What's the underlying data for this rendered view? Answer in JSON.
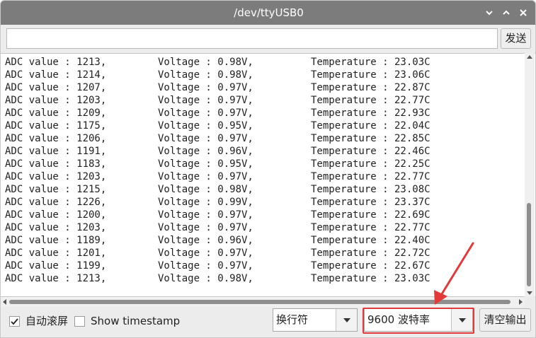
{
  "window": {
    "title": "/dev/ttyUSB0",
    "min_glyph": "▾",
    "max_glyph": "▴",
    "close_glyph": "✕"
  },
  "send": {
    "input_value": "",
    "button_label": "发送"
  },
  "output": {
    "lines": [
      {
        "adc": "ADC value : 1213,",
        "voltage": "Voltage : 0.98V,",
        "temperature": "Temperature : 23.03C"
      },
      {
        "adc": "ADC value : 1214,",
        "voltage": "Voltage : 0.98V,",
        "temperature": "Temperature : 23.06C"
      },
      {
        "adc": "ADC value : 1207,",
        "voltage": "Voltage : 0.97V,",
        "temperature": "Temperature : 22.87C"
      },
      {
        "adc": "ADC value : 1203,",
        "voltage": "Voltage : 0.97V,",
        "temperature": "Temperature : 22.77C"
      },
      {
        "adc": "ADC value : 1209,",
        "voltage": "Voltage : 0.97V,",
        "temperature": "Temperature : 22.93C"
      },
      {
        "adc": "ADC value : 1175,",
        "voltage": "Voltage : 0.95V,",
        "temperature": "Temperature : 22.04C"
      },
      {
        "adc": "ADC value : 1206,",
        "voltage": "Voltage : 0.97V,",
        "temperature": "Temperature : 22.85C"
      },
      {
        "adc": "ADC value : 1191,",
        "voltage": "Voltage : 0.96V,",
        "temperature": "Temperature : 22.46C"
      },
      {
        "adc": "ADC value : 1183,",
        "voltage": "Voltage : 0.95V,",
        "temperature": "Temperature : 22.25C"
      },
      {
        "adc": "ADC value : 1203,",
        "voltage": "Voltage : 0.97V,",
        "temperature": "Temperature : 22.77C"
      },
      {
        "adc": "ADC value : 1215,",
        "voltage": "Voltage : 0.98V,",
        "temperature": "Temperature : 23.08C"
      },
      {
        "adc": "ADC value : 1226,",
        "voltage": "Voltage : 0.99V,",
        "temperature": "Temperature : 23.37C"
      },
      {
        "adc": "ADC value : 1200,",
        "voltage": "Voltage : 0.97V,",
        "temperature": "Temperature : 22.69C"
      },
      {
        "adc": "ADC value : 1203,",
        "voltage": "Voltage : 0.97V,",
        "temperature": "Temperature : 22.77C"
      },
      {
        "adc": "ADC value : 1189,",
        "voltage": "Voltage : 0.96V,",
        "temperature": "Temperature : 22.40C"
      },
      {
        "adc": "ADC value : 1201,",
        "voltage": "Voltage : 0.97V,",
        "temperature": "Temperature : 22.72C"
      },
      {
        "adc": "ADC value : 1199,",
        "voltage": "Voltage : 0.97V,",
        "temperature": "Temperature : 22.67C"
      },
      {
        "adc": "ADC value : 1213,",
        "voltage": "Voltage : 0.98V,",
        "temperature": "Temperature : 23.03C"
      }
    ]
  },
  "footer": {
    "autoscroll": {
      "label": "自动滚屏",
      "checked": true
    },
    "timestamp": {
      "label": "Show timestamp",
      "checked": false
    },
    "line_ending": {
      "value": "换行符"
    },
    "baud_rate": {
      "value": "9600 波特率"
    },
    "clear_label": "清空输出"
  },
  "annotation": {
    "highlight_color": "#e23a3a"
  },
  "colors": {
    "titlebar": "#7c7c7c",
    "window_bg": "#ececec",
    "text": "#222222"
  }
}
